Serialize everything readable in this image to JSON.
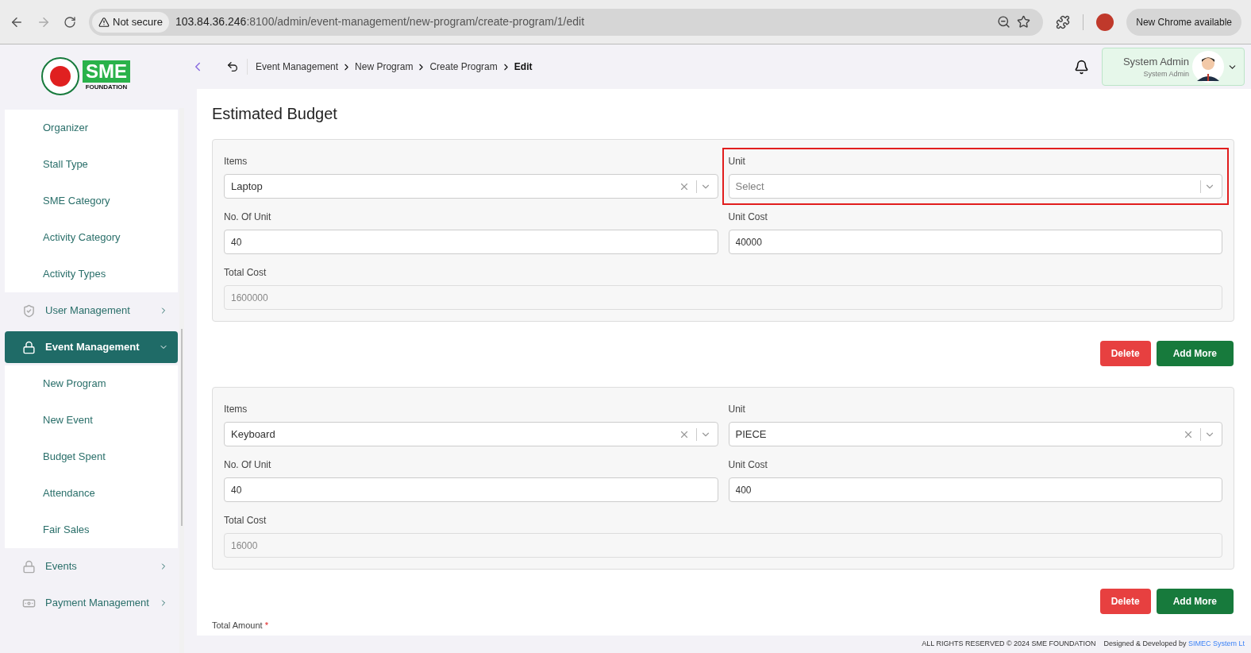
{
  "browser": {
    "security": "Not secure",
    "url_host": "103.84.36.246",
    "url_rest": ":8100/admin/event-management/new-program/create-program/1/edit",
    "update": "New Chrome available"
  },
  "logo": {
    "mark": "SME",
    "sub": "FOUNDATION"
  },
  "sidebar": {
    "items": [
      {
        "label": "Organizer",
        "kind": "sub",
        "selected": false
      },
      {
        "label": "Stall Type",
        "kind": "sub",
        "selected": false
      },
      {
        "label": "SME Category",
        "kind": "sub",
        "selected": false
      },
      {
        "label": "Activity Category",
        "kind": "sub",
        "selected": false
      },
      {
        "label": "Activity Types",
        "kind": "sub",
        "selected": false
      },
      {
        "label": "User Management",
        "kind": "group",
        "selected": false,
        "expanded": false
      },
      {
        "label": "Event Management",
        "kind": "group",
        "selected": true,
        "expanded": true
      },
      {
        "label": "New Program",
        "kind": "sub",
        "selected": false
      },
      {
        "label": "New Event",
        "kind": "sub",
        "selected": false
      },
      {
        "label": "Budget Spent",
        "kind": "sub",
        "selected": false
      },
      {
        "label": "Attendance",
        "kind": "sub",
        "selected": false
      },
      {
        "label": "Fair Sales",
        "kind": "sub",
        "selected": false
      },
      {
        "label": "Events",
        "kind": "group",
        "selected": false,
        "expanded": false
      },
      {
        "label": "Payment Management",
        "kind": "group",
        "selected": false,
        "expanded": false
      }
    ]
  },
  "breadcrumb": [
    "Event Management",
    "New Program",
    "Create Program",
    "Edit"
  ],
  "user": {
    "name": "System Admin",
    "role": "System Admin"
  },
  "page_title": "Estimated Budget",
  "budget_items": [
    {
      "items": {
        "label": "Items",
        "value": "Laptop"
      },
      "unit": {
        "label": "Unit",
        "placeholder": "Select",
        "highlighted": true
      },
      "no_of_unit": {
        "label": "No. Of Unit",
        "value": "40"
      },
      "unit_cost": {
        "label": "Unit Cost",
        "value": "40000"
      },
      "total_cost": {
        "label": "Total Cost",
        "value": "1600000"
      },
      "buttons": [
        "Delete",
        "Add More"
      ]
    },
    {
      "items": {
        "label": "Items",
        "value": "Keyboard"
      },
      "unit": {
        "label": "Unit",
        "value": "PIECE"
      },
      "no_of_unit": {
        "label": "No. Of Unit",
        "value": "40"
      },
      "unit_cost": {
        "label": "Unit Cost",
        "value": "400"
      },
      "total_cost": {
        "label": "Total Cost",
        "value": "16000"
      },
      "buttons": [
        "Delete",
        "Add More"
      ]
    }
  ],
  "total_amount": {
    "label": "Total Amount",
    "required_mark": "*"
  },
  "footer": {
    "rights": "ALL RIGHTS RESERVED © 2024 SME FOUNDATION",
    "designed": "Designed & Developed by",
    "company": "SIMEC System Lt"
  }
}
